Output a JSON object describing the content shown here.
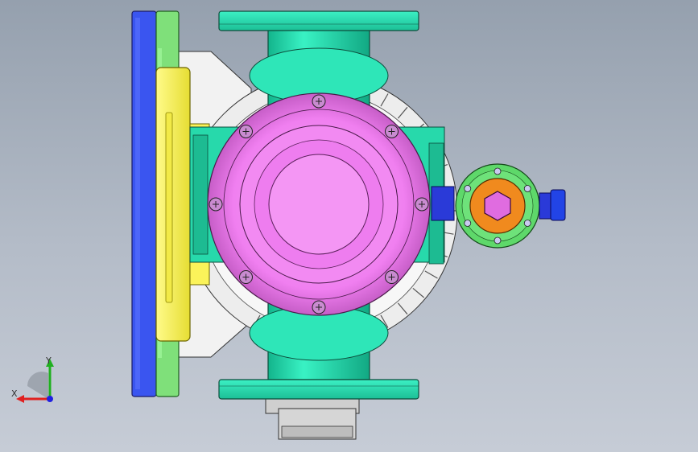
{
  "viewport": {
    "background_top": "#95a0ae",
    "background_bottom": "#c6ccd6"
  },
  "model": {
    "parts": [
      {
        "name": "blue-base-plate",
        "color": "#3a55f0"
      },
      {
        "name": "green-mount-plate",
        "color": "#7fe07a"
      },
      {
        "name": "yellow-bracket",
        "color": "#fbf35a"
      },
      {
        "name": "white-housing",
        "color": "#f4f4f4"
      },
      {
        "name": "pipe-body",
        "color": "#29e0b0"
      },
      {
        "name": "pink-cover",
        "color": "#f07ff0"
      },
      {
        "name": "side-port-flange",
        "color": "#5ed86a"
      },
      {
        "name": "orange-fitting",
        "color": "#f08a1e"
      },
      {
        "name": "hex-nut",
        "color": "#e06ce0"
      },
      {
        "name": "blue-stub",
        "color": "#2a3ad8"
      },
      {
        "name": "bottom-motor-block",
        "color": "#d8d8d8"
      }
    ],
    "bolt_count": 8,
    "side_port_hole_count": 6
  },
  "triad": {
    "x_label": "X",
    "y_label": "Y",
    "x_color": "#e02020",
    "y_color": "#20b020",
    "z_color": "#2020e0"
  }
}
